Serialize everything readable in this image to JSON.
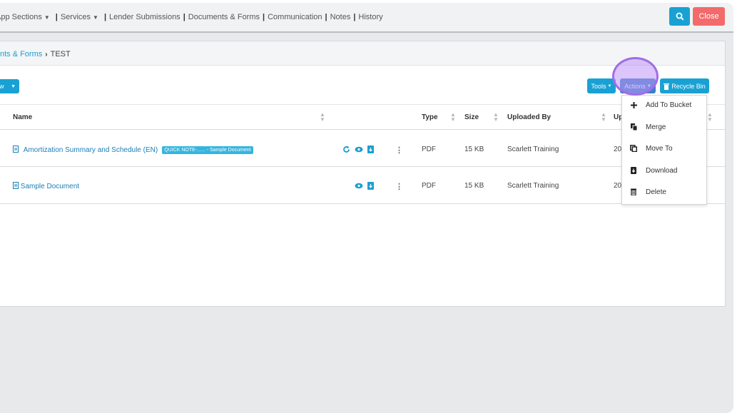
{
  "topnav": {
    "app_sections": "App Sections",
    "services": "Services",
    "links": [
      "Lender Submissions",
      "Documents & Forms",
      "Communication",
      "Notes",
      "History"
    ]
  },
  "header": {
    "close_label": "Close"
  },
  "breadcrumb": {
    "parent": "Documents & Forms",
    "current": "TEST"
  },
  "toolbar": {
    "new_label": "w",
    "tools_label": "Tools",
    "actions_label": "Actions",
    "recycle_label": "Recycle Bin"
  },
  "table": {
    "columns": {
      "name": "Name",
      "type": "Type",
      "size": "Size",
      "uploaded_by": "Uploaded By",
      "uploaded_on": "Up"
    },
    "rows": [
      {
        "name": "Amortization Summary and Schedule (EN)",
        "badge": "QUICK NOTE-...... - Sample Document",
        "type": "PDF",
        "size": "15 KB",
        "uploaded_by": "Scarlett Training",
        "uploaded_on": "20"
      },
      {
        "name": "Sample Document",
        "badge": "",
        "type": "PDF",
        "size": "15 KB",
        "uploaded_by": "Scarlett Training",
        "uploaded_on": "20"
      }
    ]
  },
  "actions_menu": [
    {
      "label": "Add To Bucket",
      "icon": "plus-icon"
    },
    {
      "label": "Merge",
      "icon": "merge-icon"
    },
    {
      "label": "Move To",
      "icon": "move-icon"
    },
    {
      "label": "Download",
      "icon": "download-icon"
    },
    {
      "label": "Delete",
      "icon": "trash-icon"
    }
  ],
  "colors": {
    "primary": "#1aa1d4",
    "actions": "#3a7fc9",
    "close": "#f26a6b",
    "badge": "#33b5e0",
    "highlight": "#9f6ee8"
  }
}
